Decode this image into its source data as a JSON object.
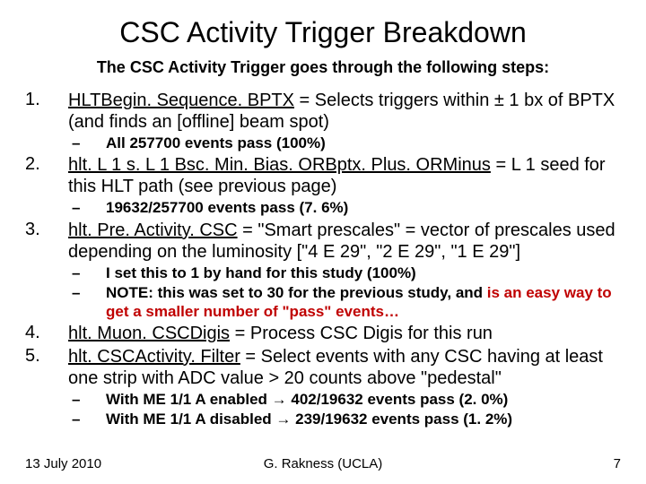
{
  "title": "CSC Activity Trigger Breakdown",
  "subtitle": "The CSC Activity Trigger goes through the following steps:",
  "items": [
    {
      "num": "1.",
      "text_a": "HLTBegin. Sequence. BPTX",
      "text_b": " = Selects triggers within ± 1 bx of BPTX (and finds an [offline] beam spot)",
      "subs": [
        {
          "text": "All 257700 events pass (100%)"
        }
      ]
    },
    {
      "num": "2.",
      "text_a": "hlt. L 1 s. L 1 Bsc. Min. Bias. ORBptx. Plus. ORMinus",
      "text_b": " = L 1 seed for this HLT path (see previous page)",
      "subs": [
        {
          "text": "19632/257700 events pass (7. 6%)"
        }
      ]
    },
    {
      "num": "3.",
      "text_a": "hlt. Pre. Activity. CSC",
      "text_b": " = \"Smart prescales\" = vector of prescales used depending on the luminosity [\"4 E 29\", \"2 E 29\", \"1 E 29\"]",
      "subs": [
        {
          "text": "I set this to 1 by hand for this study (100%)"
        },
        {
          "note_a": "NOTE:  this was set to 30 for the previous study, and ",
          "note_red": "is an easy way to get a smaller number of \"pass\" events…"
        }
      ]
    },
    {
      "num": "4.",
      "text_a": "hlt. Muon. CSCDigis",
      "text_b": " = Process CSC Digis for this run"
    },
    {
      "num": "5.",
      "text_a": "hlt. CSCActivity. Filter",
      "text_b": " = Select events with any CSC having at least one strip with ADC value > 20 counts above \"pedestal\"",
      "subs": [
        {
          "me_a": "With ME 1/1 A enabled ",
          "me_b": " 402/19632 events pass (2. 0%)"
        },
        {
          "me_a": "With ME 1/1 A disabled ",
          "me_b": " 239/19632 events pass (1. 2%)"
        }
      ]
    }
  ],
  "footer": {
    "date": "13 July 2010",
    "author": "G. Rakness (UCLA)",
    "page": "7"
  },
  "glyphs": {
    "dash": "–",
    "arrow": "→"
  }
}
